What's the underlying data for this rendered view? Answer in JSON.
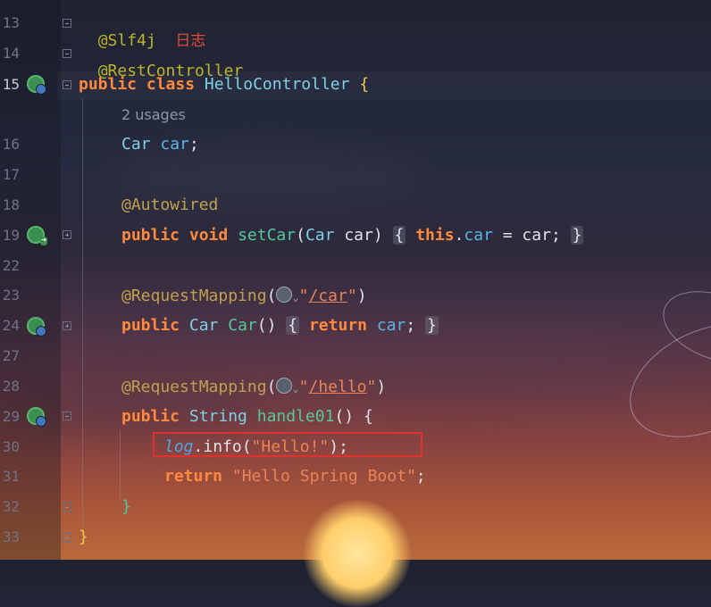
{
  "editor": {
    "line_numbers": [
      "13",
      "14",
      "15",
      "",
      "16",
      "17",
      "18",
      "19",
      "22",
      "23",
      "24",
      "27",
      "28",
      "29",
      "30",
      "31",
      "32",
      "33"
    ],
    "lines": {
      "l13_annotation": "@Slf4j",
      "l13_comment": "日志",
      "l14_annotation": "@RestController",
      "l15_public": "public",
      "l15_class": "class",
      "l15_name": "HelloController",
      "l15_brace": "{",
      "usages_hint": "2 usages",
      "l16_type": "Car",
      "l16_field": "car",
      "l16_semi": ";",
      "l18_annotation": "@Autowired",
      "l19_public": "public",
      "l19_void": "void",
      "l19_method": "setCar",
      "l19_params_open": "(",
      "l19_param_type": "Car",
      "l19_param_name": "car",
      "l19_params_close": ")",
      "l19_open": "{",
      "l19_this": "this",
      "l19_dot": ".",
      "l19_field": "car",
      "l19_assign": " = car;",
      "l19_close": "}",
      "l23_annotation": "@RequestMapping",
      "l23_paren_open": "(",
      "l23_str_q1": "\"",
      "l23_path": "/car",
      "l23_str_q2": "\"",
      "l23_paren_close": ")",
      "l24_public": "public",
      "l24_type": "Car",
      "l24_method": "Car",
      "l24_parens": "()",
      "l24_open": "{",
      "l24_return": "return",
      "l24_field": "car",
      "l24_semi": ";",
      "l24_close": "}",
      "l28_annotation": "@RequestMapping",
      "l28_paren_open": "(",
      "l28_str_q1": "\"",
      "l28_path": "/hello",
      "l28_str_q2": "\"",
      "l28_paren_close": ")",
      "l29_public": "public",
      "l29_type": "String",
      "l29_method": "handle01",
      "l29_rest": "() {",
      "l30_log": "log",
      "l30_call": ".info(",
      "l30_str": "\"Hello!\"",
      "l30_end": ");",
      "l31_return": "return",
      "l31_str": "\"Hello Spring Boot\"",
      "l31_semi": ";",
      "l32_close": "}",
      "l33_close": "}"
    }
  },
  "colors": {
    "keyword": "#e6a05a",
    "class_name": "#7fd0e6",
    "string": "#e98457",
    "annotation": "#bbb529",
    "highlight_box": "#e03030"
  },
  "icons": [
    "spring-bean-icon",
    "spring-injection-icon",
    "web-endpoint-icon",
    "globe-icon"
  ]
}
